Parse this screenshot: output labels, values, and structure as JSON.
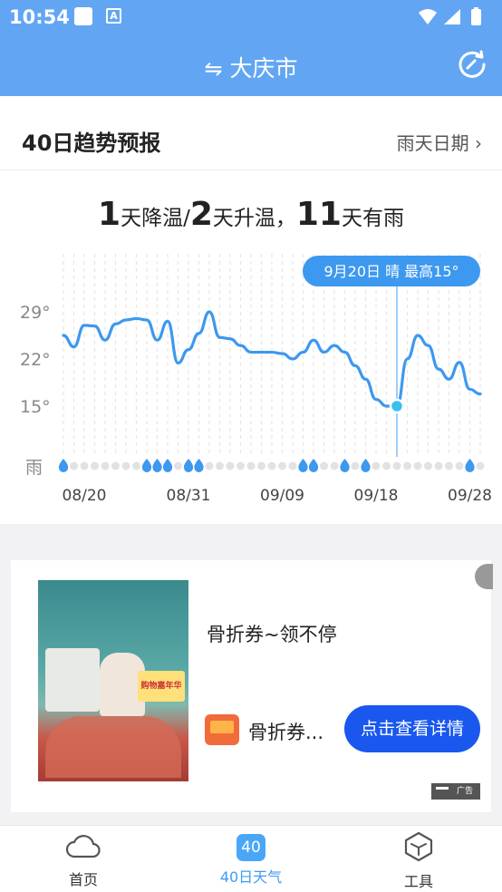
{
  "status": {
    "time": "10:54",
    "app_icon_letter": "A"
  },
  "topbar": {
    "city": "大庆市"
  },
  "header": {
    "title": "40日趋势预报",
    "rain_link": "雨天日期"
  },
  "summary": {
    "cool_days": "1",
    "cool_label": "天降温/",
    "warm_days": "2",
    "warm_label": "天升温，",
    "rain_days": "11",
    "rain_label": "天有雨"
  },
  "chart_data": {
    "type": "line",
    "y_ticks": [
      "29°",
      "22°",
      "15°"
    ],
    "y_ticks_values": [
      29,
      22,
      15
    ],
    "ylim": [
      10,
      32
    ],
    "rain_row_label": "雨",
    "x_tick_labels": [
      "08/20",
      "08/31",
      "09/09",
      "09/18",
      "09/28"
    ],
    "tooltip": "9月20日 晴 最高15°",
    "selected_index": 32,
    "series": [
      {
        "values": [
          25.5,
          23.8,
          27.0,
          26.9,
          24.8,
          27.2,
          27.8,
          28.0,
          27.8,
          24.8,
          27.6,
          21.4,
          23.4,
          25.8,
          29.0,
          25.2,
          25.0,
          24.0,
          23.0,
          23.0,
          23.0,
          22.8,
          22.0,
          23.0,
          24.8,
          23.0,
          24.0,
          23.0,
          21.0,
          19.0,
          16.0,
          15.0,
          15.0,
          22.0,
          25.5,
          24.0,
          20.5,
          19.0,
          21.5,
          17.5,
          16.8
        ]
      }
    ],
    "rain_days": [
      1,
      0,
      0,
      0,
      0,
      0,
      0,
      0,
      1,
      1,
      1,
      0,
      1,
      1,
      0,
      0,
      0,
      0,
      0,
      0,
      0,
      0,
      0,
      1,
      1,
      0,
      0,
      1,
      0,
      1,
      0,
      0,
      0,
      0,
      0,
      0,
      0,
      0,
      0,
      1,
      0
    ]
  },
  "ad": {
    "title": "骨折券~领不停",
    "subtitle": "骨折券...",
    "button": "点击查看详情",
    "badge": "广告",
    "image_text": "购物嘉年华"
  },
  "tabs": [
    {
      "label": "首页"
    },
    {
      "label": "40日天气",
      "icon_text": "40"
    },
    {
      "label": "工具"
    }
  ],
  "colors": {
    "accent": "#62a6f3",
    "line": "#3d98ef",
    "button": "#1957ef"
  }
}
